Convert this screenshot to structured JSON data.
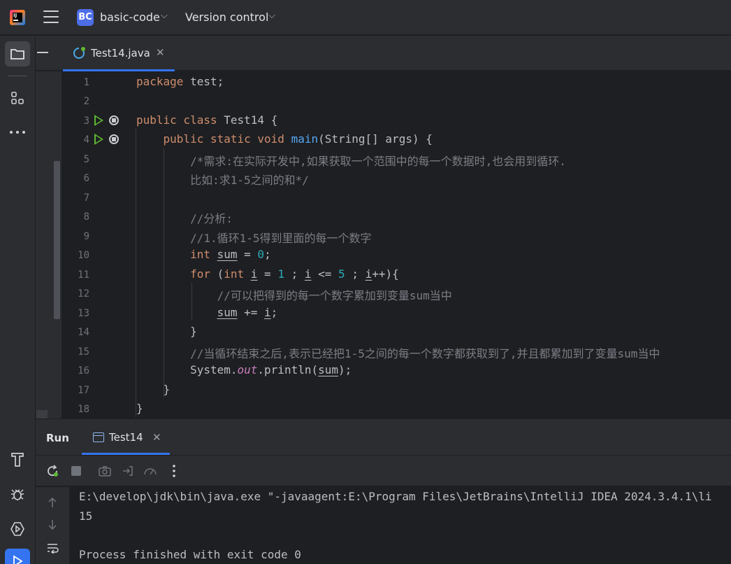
{
  "window": {
    "project_badge": "BC",
    "project_name": "basic-code",
    "version_control": "Version control"
  },
  "editor": {
    "tab_label": "Test14.java",
    "lines": [
      {
        "n": "1"
      },
      {
        "n": "2"
      },
      {
        "n": "3"
      },
      {
        "n": "4"
      },
      {
        "n": "5"
      },
      {
        "n": "6"
      },
      {
        "n": "7"
      },
      {
        "n": "8"
      },
      {
        "n": "9"
      },
      {
        "n": "10"
      },
      {
        "n": "11"
      },
      {
        "n": "12"
      },
      {
        "n": "13"
      },
      {
        "n": "14"
      },
      {
        "n": "15"
      },
      {
        "n": "16"
      },
      {
        "n": "17"
      },
      {
        "n": "18"
      }
    ],
    "code": {
      "l1_kw": "package",
      "l1_rest": " test;",
      "l3_kw": "public class",
      "l3_rest": " Test14 {",
      "l4_kw": "public static void",
      "l4_fn": "main",
      "l4_rest": "(String[] args) {",
      "l5": "/*需求:在实际开发中,如果获取一个范围中的每一个数据时,也会用到循环.",
      "l6": "比如:求1-5之间的和*/",
      "l8": "//分析:",
      "l9": "//1.循环1-5得到里面的每一个数字",
      "l10_kw": "int",
      "l10_var": "sum",
      "l10_mid": " = ",
      "l10_num": "0",
      "l10_end": ";",
      "l11_kw": "for",
      "l11_a": " (",
      "l11_kw2": "int",
      "l11_var1": "i",
      "l11_b": " = ",
      "l11_num1": "1",
      "l11_c": " ; ",
      "l11_var2": "i",
      "l11_d": " <= ",
      "l11_num2": "5",
      "l11_e": " ; ",
      "l11_var3": "i",
      "l11_f": "++){",
      "l12": "//可以把得到的每一个数字累加到变量sum当中",
      "l13_var1": "sum",
      "l13_mid": " += ",
      "l13_var2": "i",
      "l13_end": ";",
      "l14": "}",
      "l15": "//当循环结束之后,表示已经把1-5之间的每一个数字都获取到了,并且都累加到了变量sum当中",
      "l16_a": "System.",
      "l16_static": "out",
      "l16_b": ".println(",
      "l16_var": "sum",
      "l16_c": ");",
      "l17": "}",
      "l18": "}"
    }
  },
  "run_panel": {
    "title": "Run",
    "tab_label": "Test14",
    "console": [
      "E:\\develop\\jdk\\bin\\java.exe \"-javaagent:E:\\Program Files\\JetBrains\\IntelliJ IDEA 2024.3.4.1\\li",
      "15",
      "",
      "Process finished with exit code 0"
    ]
  },
  "colors": {
    "accent": "#3574f0",
    "keyword": "#cf8e6d",
    "function": "#56a8f5",
    "number": "#2aacb8",
    "comment": "#7a7e85",
    "static_field": "#c77dbb",
    "run_green": "#5fb832"
  }
}
